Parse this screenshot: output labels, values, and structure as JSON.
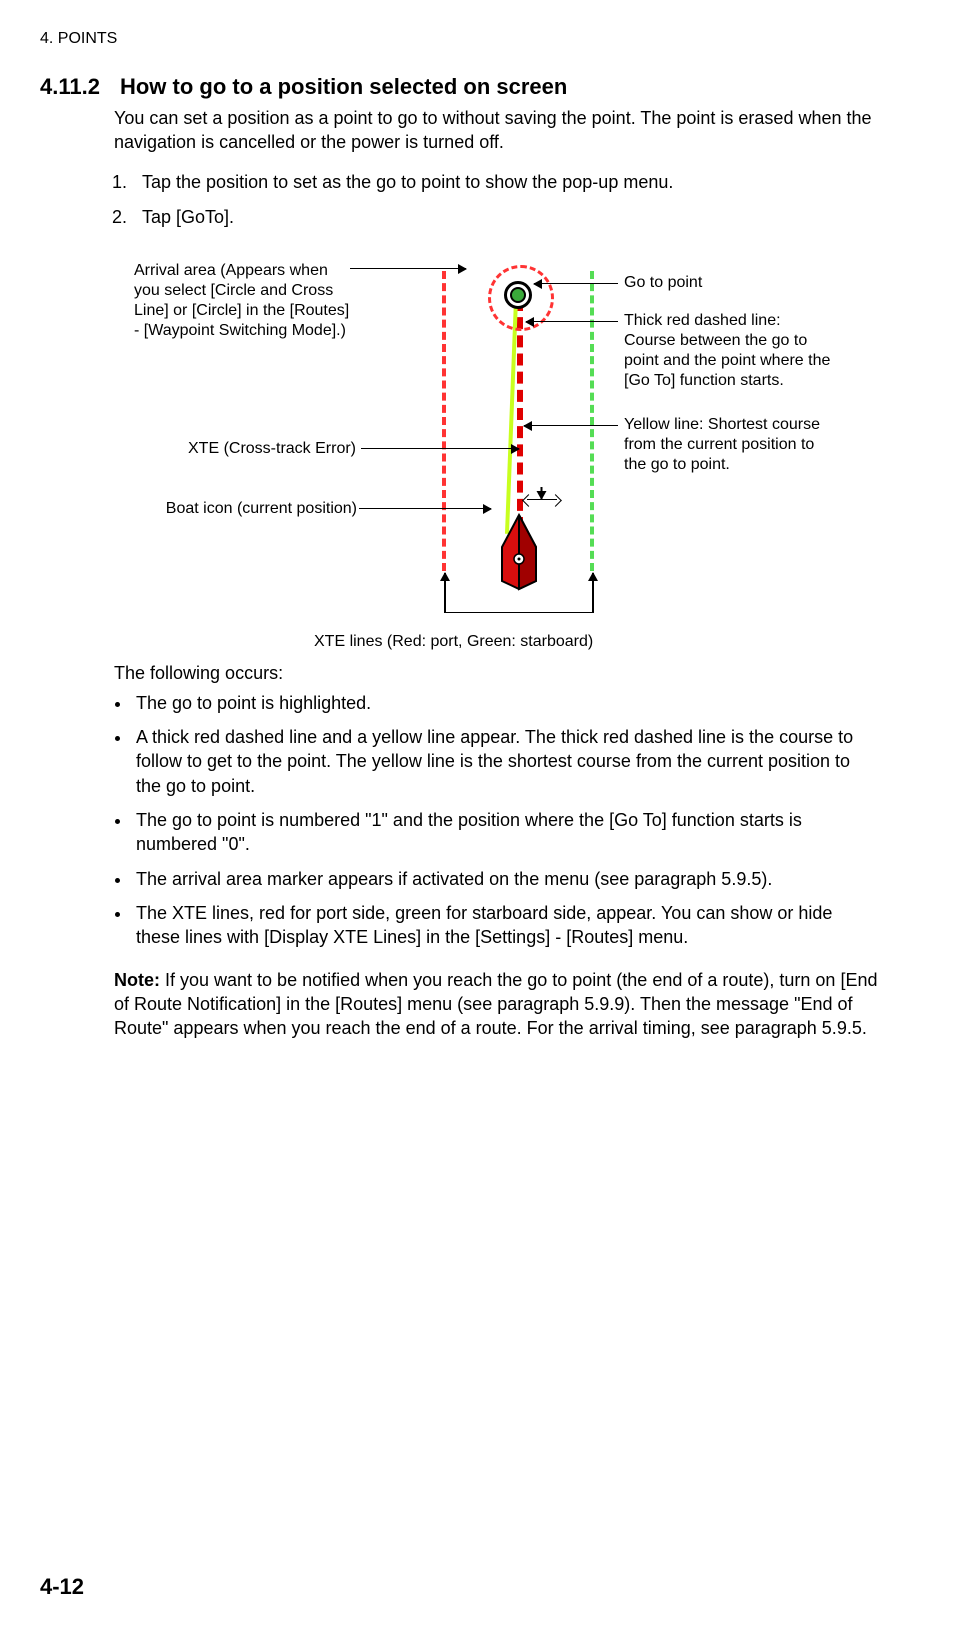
{
  "header": {
    "running": "4.  POINTS"
  },
  "section": {
    "number": "4.11.2",
    "title": "How to go to a position selected on screen",
    "intro": "You can set a position as a point to go to without saving the point. The point is erased when the navigation is cancelled or the power is turned off."
  },
  "steps": [
    "Tap the position to set as the go to point to show the pop-up menu.",
    "Tap [GoTo]."
  ],
  "diagram": {
    "labels": {
      "arrival": "Arrival area (Appears when you select [Circle and Cross Line] or [Circle] in the [Routes] - [Waypoint Switching Mode].)",
      "xte": "XTE (Cross-track Error)",
      "boat": "Boat icon (current position)",
      "goto": "Go to point",
      "thickRed": "Thick red dashed line: Course between the go to point and the point where the [Go To] function starts.",
      "yellow": "Yellow line: Shortest course from the current position to the go to point.",
      "xteLines": "XTE lines (Red: port, Green: starboard)"
    }
  },
  "after": {
    "lead": "The following occurs:",
    "bullets": [
      "The go to point is highlighted.",
      " A thick red dashed line and a yellow line appear. The thick red dashed line is the course to follow to get to the point. The yellow line is the shortest course from the current position to the go to point.",
      "The go to point is numbered \"1\" and the position where the [Go To] function starts is numbered \"0\".",
      "The arrival area marker appears if activated on the menu (see paragraph 5.9.5).",
      "The XTE lines, red for port side, green for starboard side, appear. You can show or hide these lines with [Display XTE Lines] in the [Settings] - [Routes] menu."
    ],
    "note_label": "Note:",
    "note": " If you want to be notified when you reach the go to point (the end of a route), turn on [End of Route Notification] in the [Routes] menu (see paragraph 5.9.9). Then the message \"End of Route\" appears when you reach the end of a route. For the arrival timing, see paragraph 5.9.5."
  },
  "page_number": "4-12"
}
